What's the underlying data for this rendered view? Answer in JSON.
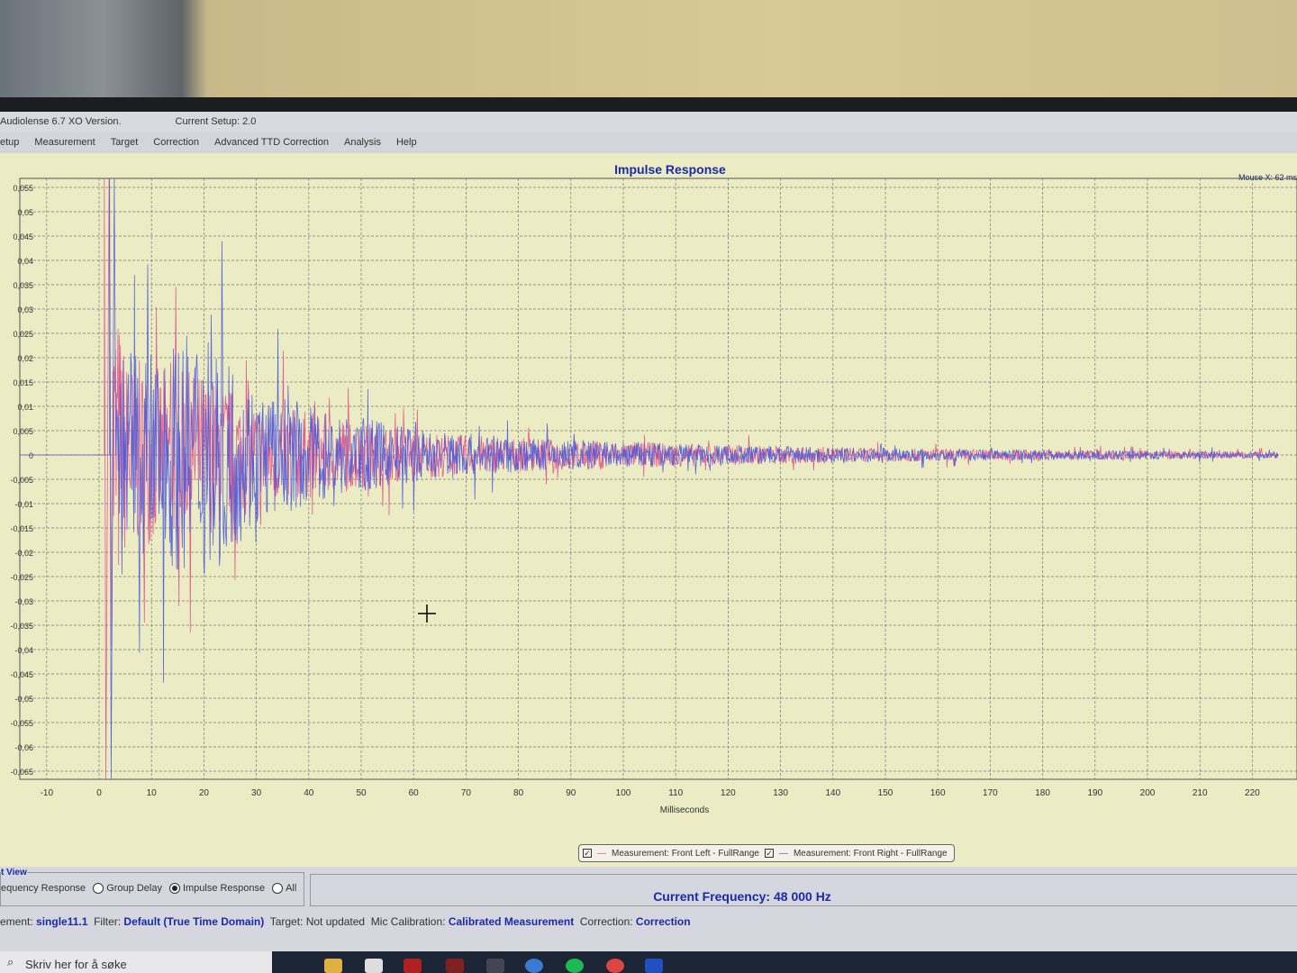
{
  "app": {
    "title": "Audiolense 6.7 XO Version.",
    "setup": "Current Setup: 2.0"
  },
  "menu": [
    "etup",
    "Measurement",
    "Target",
    "Correction",
    "Advanced TTD Correction",
    "Analysis",
    "Help"
  ],
  "mouse_readout": "Mouse X: 62 ms",
  "legend": [
    {
      "label": "Measurement: Front Left - FullRange",
      "checked": true,
      "color": "#e0508a"
    },
    {
      "label": "Measurement: Front Right - FullRange",
      "checked": true,
      "color": "#4a5adc"
    }
  ],
  "view": {
    "group_label": "t View",
    "options": [
      {
        "label": "equency Response",
        "selected": false,
        "radio": false
      },
      {
        "label": "Group Delay",
        "selected": false,
        "radio": true
      },
      {
        "label": "Impulse Response",
        "selected": true,
        "radio": true
      },
      {
        "label": "All",
        "selected": false,
        "radio": true
      }
    ]
  },
  "current_frequency": "Current Frequency: 48 000 Hz",
  "status": {
    "l1": "ement:",
    "v1": "single11.1",
    "l2": "Filter:",
    "v2": "Default (True Time Domain)",
    "l3": "Target:",
    "v3": "Not updated",
    "l4": "Mic Calibration:",
    "v4": "Calibrated Measurement",
    "l5": "Correction:",
    "v5": "Correction"
  },
  "taskbar": {
    "search_placeholder": "Skriv her for å søke"
  },
  "chart_data": {
    "type": "line",
    "title": "Impulse Response",
    "xlabel": "Milliseconds",
    "ylabel": "",
    "xlim": [
      -12,
      225
    ],
    "ylim": [
      -0.065,
      0.057
    ],
    "xticks": [
      -10,
      0,
      10,
      20,
      30,
      40,
      50,
      60,
      70,
      80,
      90,
      100,
      110,
      120,
      130,
      140,
      150,
      160,
      170,
      180,
      190,
      200,
      210,
      220
    ],
    "yticks": [
      "0,055",
      "0,05",
      "0,045",
      "0,04",
      "0,035",
      "0,03",
      "0,025",
      "0,02",
      "0,015",
      "0,01",
      "0,005",
      "0",
      "-0,005",
      "-0,01",
      "-0,015",
      "-0,02",
      "-0,025",
      "-0,03",
      "-0,035",
      "-0,04",
      "-0,045",
      "-0,05",
      "-0,055",
      "-0,06",
      "-0,065"
    ],
    "grid": true,
    "legend_position": "bottom-center",
    "envelope_x_ms": [
      2,
      5,
      10,
      20,
      30,
      40,
      50,
      60,
      80,
      100,
      120,
      150,
      180,
      220
    ],
    "series": [
      {
        "name": "Measurement: Front Left - FullRange",
        "color": "#e0508a",
        "onset_ms": 1,
        "peak": 0.06,
        "envelope": [
          0.06,
          0.03,
          0.026,
          0.024,
          0.016,
          0.013,
          0.01,
          0.007,
          0.005,
          0.004,
          0.003,
          0.002,
          0.0015,
          0.001
        ]
      },
      {
        "name": "Measurement: Front Right - FullRange",
        "color": "#4a5adc",
        "onset_ms": 2,
        "peak": 0.06,
        "envelope": [
          0.06,
          0.03,
          0.03,
          0.038,
          0.02,
          0.015,
          0.011,
          0.008,
          0.005,
          0.004,
          0.003,
          0.002,
          0.0015,
          0.001
        ]
      }
    ]
  }
}
